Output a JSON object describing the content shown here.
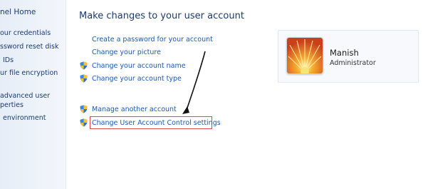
{
  "sidebar": {
    "title": "nel Home",
    "items": [
      {
        "label": "our credentials"
      },
      {
        "label": "ssword reset disk"
      },
      {
        "label": "IDs"
      },
      {
        "label": "ur file encryption"
      },
      {
        "label": "advanced user"
      },
      {
        "label": "perties"
      },
      {
        "label": "environment"
      }
    ]
  },
  "main": {
    "title": "Make changes to your user account",
    "links": {
      "create_password": "Create a password for your account",
      "change_picture": "Change your picture",
      "change_name": "Change your account name",
      "change_type": "Change your account type",
      "manage_another": "Manage another account",
      "uac_settings": "Change User Account Control settings"
    }
  },
  "user": {
    "name": "Manish",
    "role": "Administrator"
  },
  "icons": {
    "shield": "uac-shield-icon",
    "user_picture": "flower-picture-icon",
    "arrow": "annotation-arrow"
  },
  "colors": {
    "link": "#1a5ab8",
    "title": "#1c3a6e",
    "highlight": "#e04848"
  }
}
